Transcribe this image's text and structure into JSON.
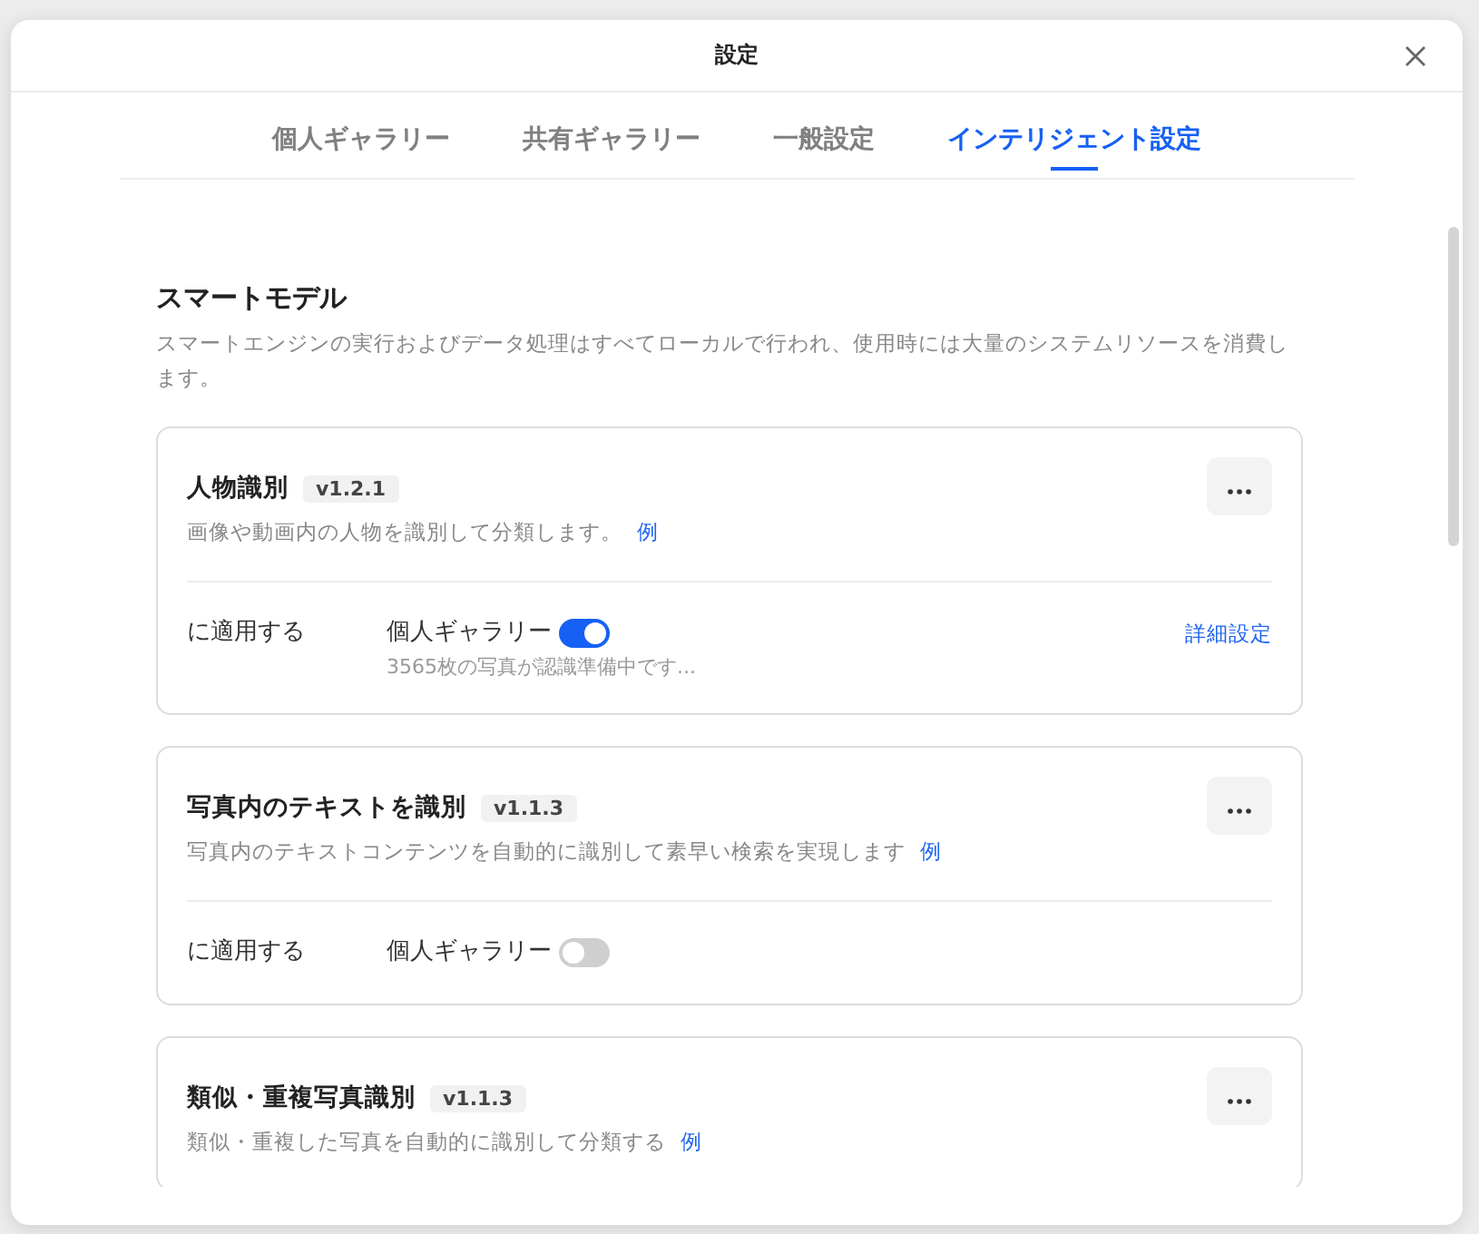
{
  "window": {
    "title": "設定"
  },
  "tabs": [
    {
      "label": "個人ギャラリー",
      "selected": false
    },
    {
      "label": "共有ギャラリー",
      "selected": false
    },
    {
      "label": "一般設定",
      "selected": false
    },
    {
      "label": "インテリジェント設定",
      "selected": true
    }
  ],
  "section": {
    "title": "スマートモデル",
    "description": "スマートエンジンの実行およびデータ処理はすべてローカルで行われ、使用時には大量のシステムリソースを消費します。"
  },
  "models": [
    {
      "name": "人物識別",
      "version": "v1.2.1",
      "description": "画像や動画内の人物を識別して分類します。",
      "example_link": "例",
      "apply_label": "に適用する",
      "targets": [
        {
          "label": "個人ギャラリー",
          "on": true,
          "status": "3565枚の写真が認識準備中です..."
        }
      ],
      "advanced_link": "詳細設定"
    },
    {
      "name": "写真内のテキストを識別",
      "version": "v1.1.3",
      "description": "写真内のテキストコンテンツを自動的に識別して素早い検索を実現します",
      "example_link": "例",
      "apply_label": "に適用する",
      "targets": [
        {
          "label": "個人ギャラリー",
          "on": false
        }
      ]
    },
    {
      "name": "類似・重複写真識別",
      "version": "v1.1.3",
      "description": "類似・重複した写真を自動的に識別して分類する",
      "example_link": "例"
    }
  ]
}
